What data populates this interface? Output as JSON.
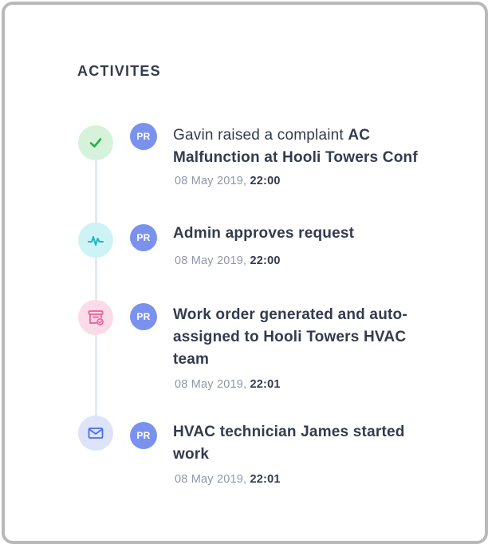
{
  "header": {
    "title": "ACTIVITES"
  },
  "colors": {
    "text": "#333b4d",
    "muted": "#8f97a8",
    "avatar": "#7a92ee",
    "line": "#e4e9f2"
  },
  "activities": [
    {
      "icon": "check-icon",
      "icon_bg": "#d7f2da",
      "icon_color": "#26b245",
      "avatar": "PR",
      "text_plain": "Gavin raised a complaint ",
      "text_strong": "AC Malfunction at Hooli Towers Conf",
      "date": "08 May 2019",
      "sep": ", ",
      "time": "22:00"
    },
    {
      "icon": "pulse-icon",
      "icon_bg": "#cdf3f6",
      "icon_color": "#1ab6c7",
      "avatar": "PR",
      "text_plain": "",
      "text_strong": "Admin approves request",
      "date": "08 May 2019",
      "sep": ", ",
      "time": "22:00"
    },
    {
      "icon": "archive-check-icon",
      "icon_bg": "#fbdbe8",
      "icon_color": "#ee5b94",
      "avatar": "PR",
      "text_plain": "",
      "text_strong": "Work order generated and auto-assigned to Hooli Towers HVAC team",
      "date": "08 May 2019",
      "sep": ", ",
      "time": "22:01"
    },
    {
      "icon": "mail-icon",
      "icon_bg": "#dce3fb",
      "icon_color": "#4e6ee8",
      "avatar": "PR",
      "text_plain": "",
      "text_strong": "HVAC technician James started work",
      "date": "08 May 2019",
      "sep": ", ",
      "time": "22:01"
    }
  ]
}
